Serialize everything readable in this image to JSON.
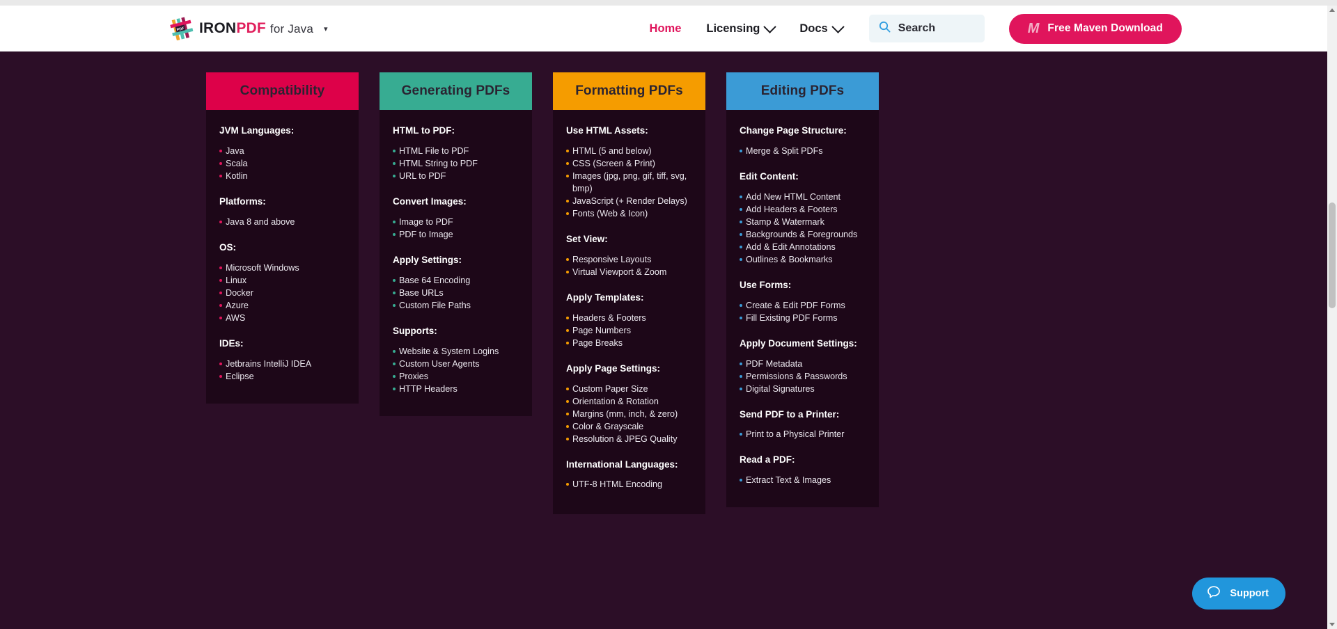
{
  "header": {
    "brand_primary": "IRON",
    "brand_accent": "PDF",
    "brand_sub": "for Java",
    "brand_caret": "▾",
    "nav": [
      {
        "label": "Home",
        "has_chevron": false,
        "active": true
      },
      {
        "label": "Licensing",
        "has_chevron": true,
        "active": false
      },
      {
        "label": "Docs",
        "has_chevron": true,
        "active": false
      }
    ],
    "search": {
      "placeholder": "Search",
      "icon": "search-icon"
    },
    "cta": {
      "icon_label": "M",
      "label": "Free Maven Download",
      "color": "#e0155c"
    }
  },
  "support": {
    "label": "Support",
    "icon": "chat-bubble-icon",
    "color": "#2196dc"
  },
  "cards": [
    {
      "title": "Compatibility",
      "header_color": "#dd0149",
      "bullet_color": "#e0155c",
      "groups": [
        {
          "title": "JVM Languages:",
          "items": [
            "Java",
            "Scala",
            "Kotlin"
          ]
        },
        {
          "title": "Platforms:",
          "items": [
            "Java 8 and above"
          ]
        },
        {
          "title": "OS:",
          "items": [
            "Microsoft Windows",
            "Linux",
            "Docker",
            "Azure",
            "AWS"
          ]
        },
        {
          "title": "IDEs:",
          "items": [
            "Jetbrains IntelliJ IDEA",
            "Eclipse"
          ]
        }
      ]
    },
    {
      "title": "Generating PDFs",
      "header_color": "#37ac92",
      "bullet_color": "#37ac92",
      "groups": [
        {
          "title": "HTML to PDF:",
          "items": [
            "HTML File to PDF",
            "HTML String to PDF",
            "URL to PDF"
          ]
        },
        {
          "title": "Convert Images:",
          "items": [
            "Image to PDF",
            "PDF to Image"
          ]
        },
        {
          "title": "Apply Settings:",
          "items": [
            "Base 64 Encoding",
            "Base URLs",
            "Custom File Paths"
          ]
        },
        {
          "title": "Supports:",
          "items": [
            "Website & System Logins",
            "Custom User Agents",
            "Proxies",
            "HTTP Headers"
          ]
        }
      ]
    },
    {
      "title": "Formatting PDFs",
      "header_color": "#f59c00",
      "bullet_color": "#f59c00",
      "groups": [
        {
          "title": "Use HTML Assets:",
          "items": [
            "HTML (5 and below)",
            "CSS (Screen & Print)",
            "Images (jpg, png, gif, tiff, svg, bmp)",
            "JavaScript (+ Render Delays)",
            "Fonts (Web & Icon)"
          ]
        },
        {
          "title": "Set View:",
          "items": [
            "Responsive Layouts",
            "Virtual Viewport & Zoom"
          ]
        },
        {
          "title": "Apply Templates:",
          "items": [
            "Headers & Footers",
            "Page Numbers",
            "Page Breaks"
          ]
        },
        {
          "title": "Apply Page Settings:",
          "items": [
            "Custom Paper Size",
            "Orientation & Rotation",
            "Margins (mm, inch, & zero)",
            "Color & Grayscale",
            "Resolution & JPEG Quality"
          ]
        },
        {
          "title": "International Languages:",
          "items": [
            "UTF-8 HTML Encoding"
          ]
        }
      ]
    },
    {
      "title": "Editing PDFs",
      "header_color": "#3b9bd6",
      "bullet_color": "#3b9bd6",
      "groups": [
        {
          "title": "Change Page Structure:",
          "items": [
            "Merge & Split PDFs"
          ]
        },
        {
          "title": "Edit Content:",
          "items": [
            "Add New HTML Content",
            "Add Headers & Footers",
            "Stamp & Watermark",
            "Backgrounds & Foregrounds",
            "Add & Edit Annotations",
            "Outlines & Bookmarks"
          ]
        },
        {
          "title": "Use Forms:",
          "items": [
            "Create & Edit PDF Forms",
            "Fill Existing PDF Forms"
          ]
        },
        {
          "title": "Apply Document Settings:",
          "items": [
            "PDF Metadata",
            "Permissions & Passwords",
            "Digital Signatures"
          ]
        },
        {
          "title": "Send PDF to a Printer:",
          "items": [
            "Print to a Physical Printer"
          ]
        },
        {
          "title": "Read a PDF:",
          "items": [
            "Extract Text & Images"
          ]
        }
      ]
    }
  ]
}
